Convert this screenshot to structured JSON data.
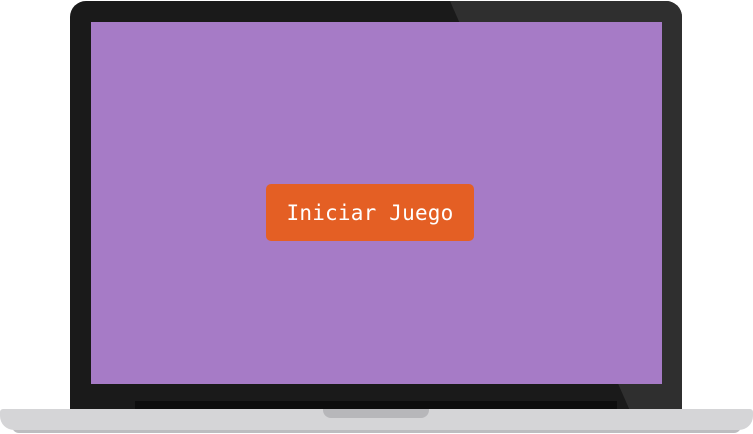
{
  "screen": {
    "background_color": "#a67bc6",
    "start_button": {
      "label": "Iniciar Juego",
      "color": "#e45f24",
      "text_color": "#ffffff"
    }
  },
  "device": {
    "type": "laptop",
    "bezel_color": "#1a1a1a",
    "base_color": "#d5d5d7"
  }
}
